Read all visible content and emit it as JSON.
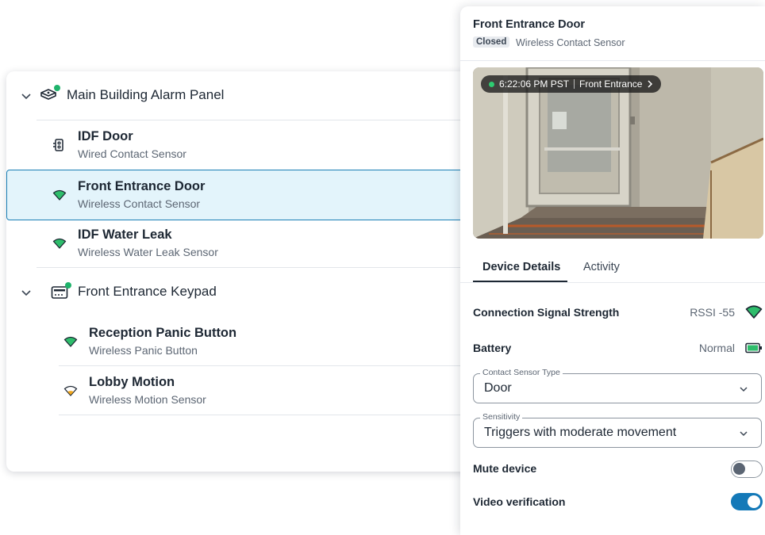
{
  "tree": {
    "groups": [
      {
        "title": "Main Building Alarm Panel",
        "devices": [
          {
            "name": "IDF Door",
            "type": "Wired Contact Sensor",
            "icon": "wired-contact-icon"
          },
          {
            "name": "Front Entrance Door",
            "type": "Wireless Contact Sensor",
            "icon": "wifi-signal-icon",
            "selected": true
          },
          {
            "name": "IDF Water Leak",
            "type": "Wireless Water Leak Sensor",
            "icon": "wifi-signal-icon"
          }
        ]
      },
      {
        "title": "Front Entrance Keypad",
        "devices": [
          {
            "name": "Reception Panic Button",
            "type": "Wireless Panic Button",
            "icon": "wifi-signal-icon"
          },
          {
            "name": "Lobby Motion",
            "type": "Wireless Motion Sensor",
            "icon": "wifi-signal-weak-icon"
          }
        ]
      }
    ]
  },
  "panel": {
    "title": "Front Entrance Door",
    "status": "Closed",
    "subtitle": "Wireless Contact Sensor",
    "camera": {
      "time": "6:22:06 PM PST",
      "name": "Front Entrance"
    },
    "tabs": [
      "Device Details",
      "Activity"
    ],
    "signal_label": "Connection Signal Strength",
    "signal_value": "RSSI -55",
    "battery_label": "Battery",
    "battery_value": "Normal",
    "contact_type_legend": "Contact Sensor Type",
    "contact_type_value": "Door",
    "sensitivity_legend": "Sensitivity",
    "sensitivity_value": "Triggers with moderate movement",
    "mute_label": "Mute device",
    "mute_on": false,
    "video_label": "Video verification",
    "video_on": true
  },
  "colors": {
    "accent": "#1479b8",
    "online": "#1fb36b",
    "signal_good": "#2ebd6b",
    "signal_weak": "#f2a81d",
    "selected_bg": "#e3f4fb"
  }
}
